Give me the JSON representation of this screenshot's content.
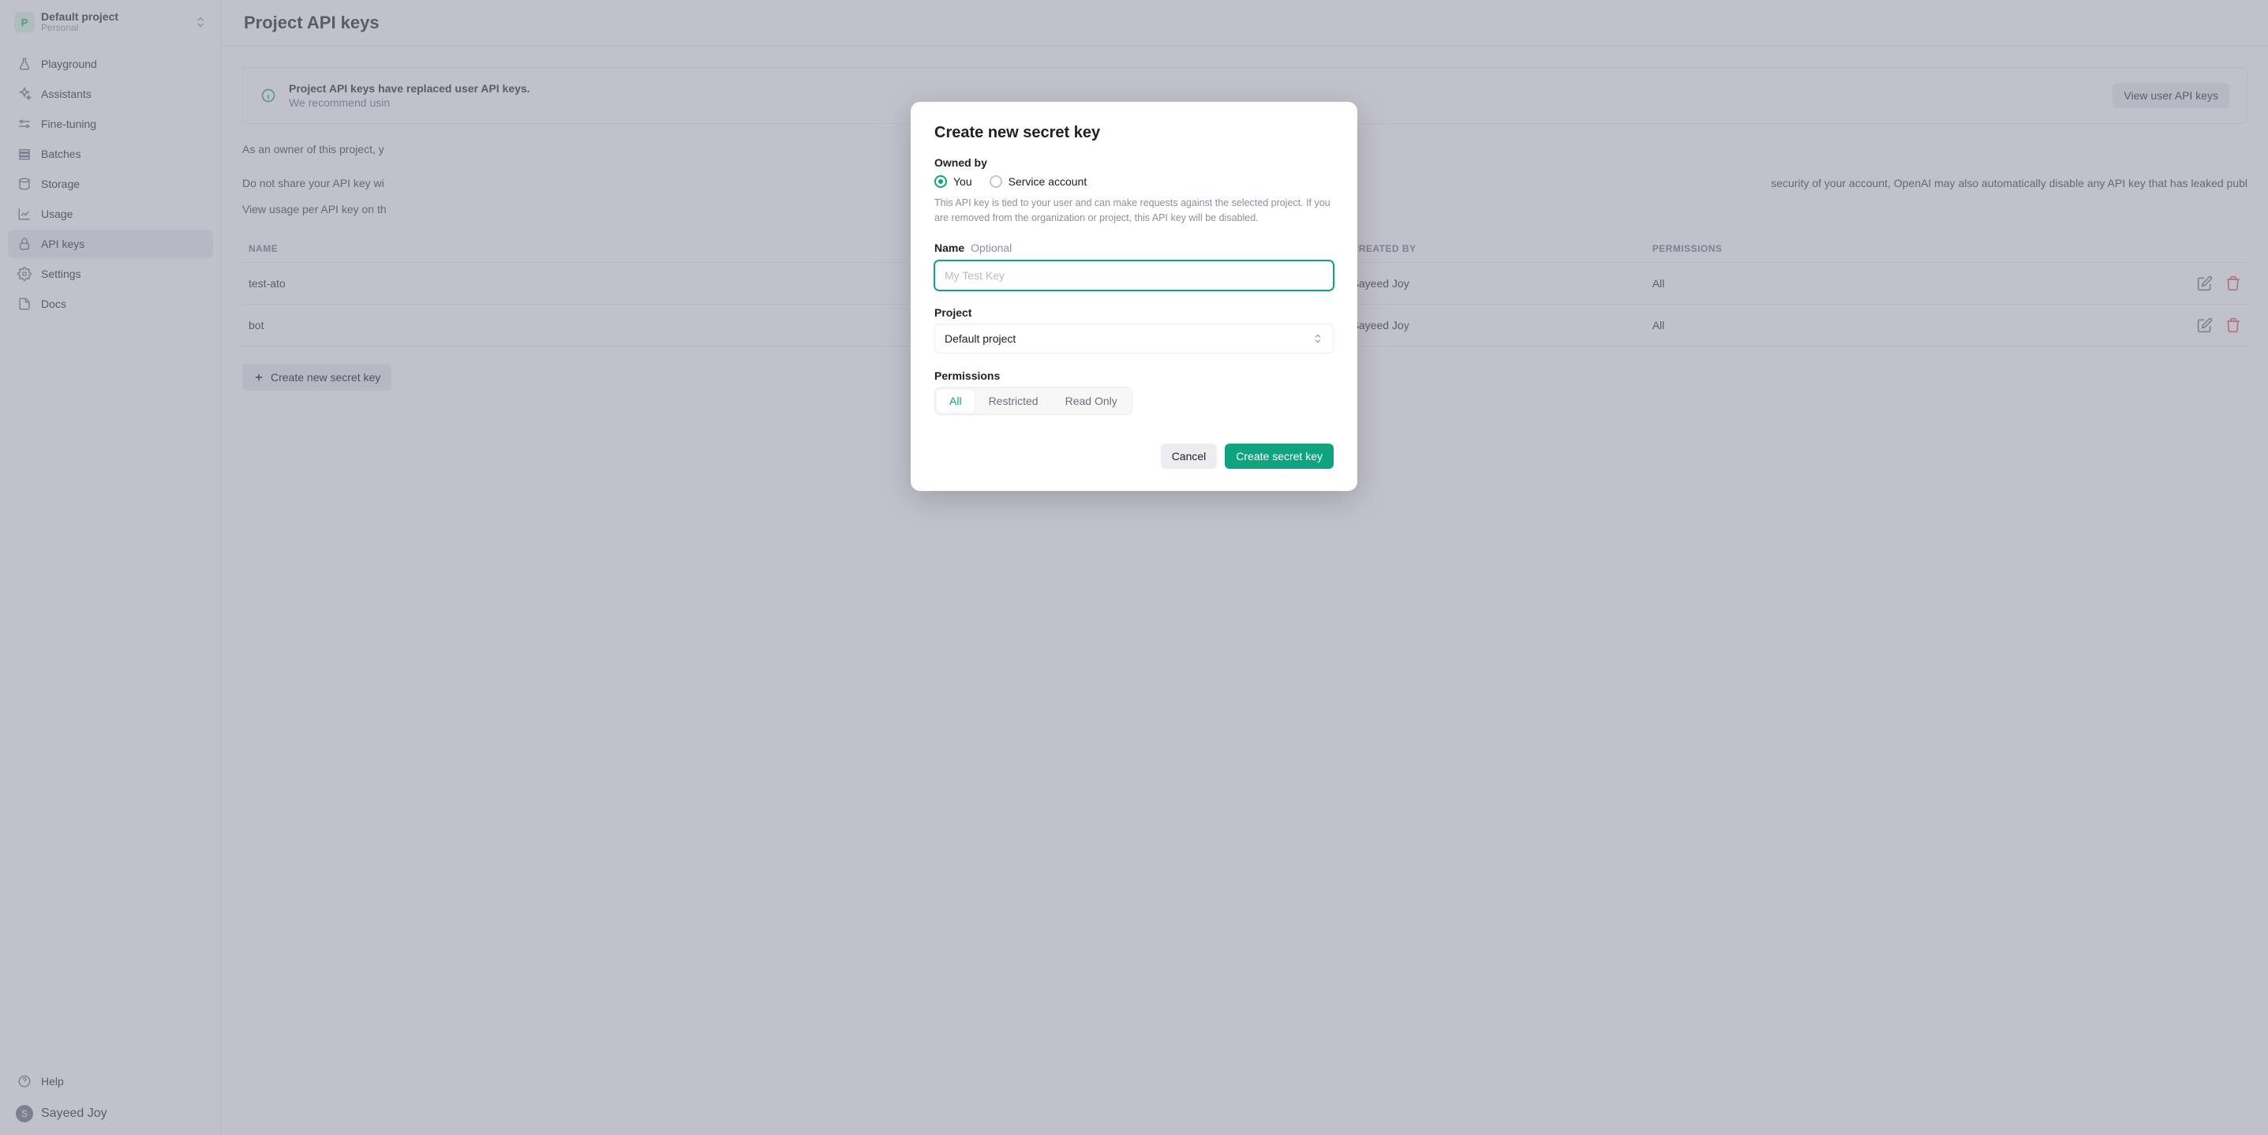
{
  "sidebar": {
    "project_initial": "P",
    "project_name": "Default project",
    "project_scope": "Personal",
    "nav": [
      {
        "label": "Playground",
        "icon": "flask"
      },
      {
        "label": "Assistants",
        "icon": "sparkle"
      },
      {
        "label": "Fine-tuning",
        "icon": "sliders"
      },
      {
        "label": "Batches",
        "icon": "stack"
      },
      {
        "label": "Storage",
        "icon": "drive"
      },
      {
        "label": "Usage",
        "icon": "chart"
      },
      {
        "label": "API keys",
        "icon": "lock",
        "active": true
      },
      {
        "label": "Settings",
        "icon": "gear"
      },
      {
        "label": "Docs",
        "icon": "doc"
      }
    ],
    "help_label": "Help",
    "user_initial": "S",
    "user_name": "Sayeed Joy"
  },
  "page": {
    "title": "Project API keys",
    "notice_title": "Project API keys have replaced user API keys.",
    "notice_body": "We recommend usin",
    "view_user_keys_label": "View user API keys",
    "para_owner": "As an owner of this project, y",
    "para_share": "Do not share your API key wi",
    "para_share2": "security of your account, OpenAI may also automatically disable any API key that has leaked publ",
    "para_usage": "View usage per API key on th"
  },
  "table": {
    "col_name": "NAME",
    "col_created_by": "CREATED BY",
    "col_permissions": "PERMISSIONS",
    "rows": [
      {
        "name": "test-ato",
        "created_by": "Sayeed Joy",
        "permissions": "All"
      },
      {
        "name": "bot",
        "created_by": "Sayeed Joy",
        "permissions": "All"
      }
    ],
    "create_label": "Create new secret key"
  },
  "modal": {
    "title": "Create new secret key",
    "owned_by_label": "Owned by",
    "owner_you": "You",
    "owner_service": "Service account",
    "owner_help": "This API key is tied to your user and can make requests against the selected project. If you are removed from the organization or project, this API key will be disabled.",
    "name_label": "Name",
    "optional_label": "Optional",
    "name_placeholder": "My Test Key",
    "project_label": "Project",
    "project_value": "Default project",
    "permissions_label": "Permissions",
    "perm_all": "All",
    "perm_restricted": "Restricted",
    "perm_readonly": "Read Only",
    "cancel_label": "Cancel",
    "submit_label": "Create secret key"
  }
}
